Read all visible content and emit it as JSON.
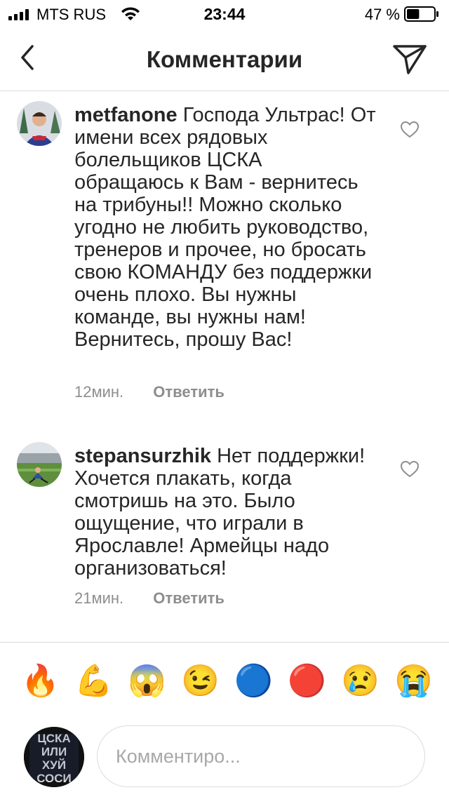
{
  "status_bar": {
    "carrier": "MTS RUS",
    "time": "23:44",
    "battery_percent": "47 %",
    "battery_level": 0.47,
    "icons": [
      "signal-icon",
      "wifi-icon",
      "battery-icon"
    ]
  },
  "header": {
    "title": "Комментарии",
    "back_icon": "chevron-left-icon",
    "send_icon": "direct-send-icon"
  },
  "comments": [
    {
      "username": "metfanone",
      "text": "Господа Ультрас! От имени всех рядовых болельщиков ЦСКА обращаюсь к Вам - вернитесь на трибуны!! Можно сколько угодно не любить руководство, тренеров и прочее, но бросать свою КОМАНДУ без поддержки очень плохо. Вы нужны команде, вы нужны нам! Вернитесь, прошу Вас!",
      "time": "12мин.",
      "reply_label": "Ответить"
    },
    {
      "username": "stepansurzhik",
      "text": "Нет поддержки! Хочется плакать, когда смотришь на это. Было ощущение, что играли в Ярославле! Армейцы надо организоваться!",
      "time": "21мин.",
      "reply_label": "Ответить"
    }
  ],
  "emoji_bar": [
    "🔥",
    "💪",
    "😱",
    "😉",
    "🔵",
    "🔴",
    "😢",
    "😭"
  ],
  "composer": {
    "placeholder": "Комментиро...",
    "avatar_lettering": "ЦСКА ИЛИ ХУЙ СОСИ"
  }
}
